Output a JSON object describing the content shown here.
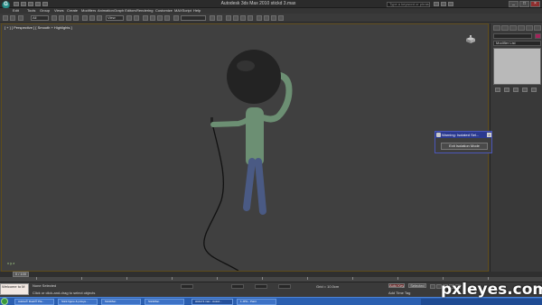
{
  "window": {
    "title": "Autodesk 3ds Max 2010    stickd 3.max",
    "search_placeholder": "Type a keyword or phrase",
    "app_logo": "G",
    "minimize": "_",
    "maximize": "□",
    "close": "×"
  },
  "menu": [
    "Edit",
    "Tools",
    "Group",
    "Views",
    "Create",
    "Modifiers",
    "Animation",
    "Graph Editors",
    "Rendering",
    "Customize",
    "MAXScript",
    "Help"
  ],
  "toolbar": {
    "selection_filter": "All",
    "reference_coord": "View",
    "named_selection": ""
  },
  "viewport": {
    "label": "[ + ] [ Perspective ] [ Smooth + Highlights ]",
    "axis_label": "x y z"
  },
  "command_panel": {
    "modifier_list": "Modifier List",
    "object_color": "#a3235a"
  },
  "isolate_dialog": {
    "title": "Warning: Isolated Sel...",
    "button": "Exit Isolation Mode",
    "close": "×"
  },
  "timeline": {
    "frame_readout": "0 / 100",
    "tick_labels": [
      "0",
      "10",
      "20",
      "30",
      "40",
      "50",
      "60",
      "70",
      "80",
      "90",
      "100"
    ]
  },
  "status": {
    "maxscript_prompt": "Welcome to M",
    "selection": "None Selected",
    "prompt": "Click or click-and-drag to select objects",
    "auto_key": "Auto Key",
    "set_key": "Set Key",
    "key_filters": "Key Filters...",
    "selected_dropdown": "Selected",
    "add_time_tag": "Add Time Tag",
    "grid": "Grid = 10.0cm"
  },
  "taskbar": {
    "items": [
      {
        "label": "Adobe® Flash® Pla...",
        "active": false
      },
      {
        "label": "Stick figure & pxleye...",
        "active": false
      },
      {
        "label": "StickMan",
        "active": false
      },
      {
        "label": "StickMan",
        "active": false
      },
      {
        "label": "stickd 3.max - Autod...",
        "active": true
      },
      {
        "label": "1.JPG - Paint",
        "active": false
      }
    ]
  },
  "watermark": "pxleyes.com"
}
